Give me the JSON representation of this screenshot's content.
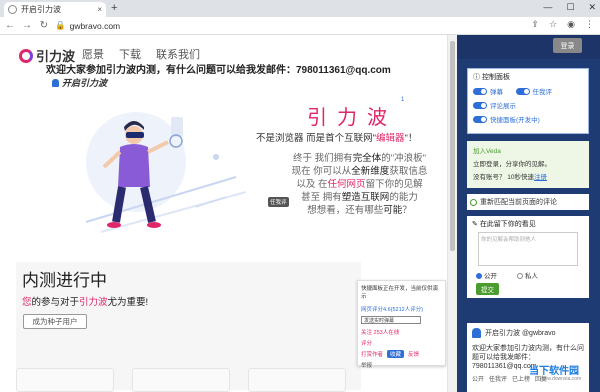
{
  "browser": {
    "tab_title": "开启引力波",
    "tab_close": "×",
    "new_tab": "+",
    "url": "gwbravo.com",
    "win_min": "—",
    "win_max": "☐",
    "win_close": "✕"
  },
  "site": {
    "logo_text": "引力波",
    "nav": [
      "愿景",
      "下载",
      "联系我们"
    ],
    "welcome": "欢迎大家参加引力波内测，有什么问题可以给我发邮件：798011361@qq.com",
    "start_label": "开启引力波",
    "hero_title": "引力波",
    "hero_version": "1",
    "line1_prefix": "不是浏览器 而是首个互联网\"",
    "line1_highlight": "编辑器",
    "line1_suffix": "\"！",
    "para_1": "终于 我们拥有",
    "para_1b": "完全体",
    "para_1c": "的\"冲浪板\"",
    "para_2": "现在 你可以从",
    "para_2b": "全新维度",
    "para_2c": "获取信息",
    "para_3": "以及 在",
    "para_3b": "任何网页",
    "para_3c": "留下你的见解",
    "para_4": "甚至 拥有",
    "para_4b": "塑造互联网",
    "para_4c": "的能力",
    "para_5": "想想看，还有哪些",
    "para_5b": "可能",
    "para_5c": "？",
    "tooltip": "任我评",
    "beta_title": "内测进行中",
    "beta_sub_pre": "您",
    "beta_sub_mid": "的参与对于",
    "beta_sub_pk": "引力波",
    "beta_sub_post": "尤为重要!",
    "beta_button": "成为种子用户"
  },
  "popup": {
    "title": "快捷面板正在开发，当前仅供演示",
    "version_line": "网页评分4.6(5212人评分)",
    "input_value": "发送实时弹幕",
    "row1": "关注    253人在线",
    "row2": "评分",
    "footer_left": "打赏作者",
    "footer_btn": "收藏",
    "footer_right": "反馈",
    "last": "举报"
  },
  "sidebar": {
    "login": "登录",
    "control_title": "控制面板",
    "toggles": [
      "弹幕",
      "任我评",
      "评论展示",
      "快捷面板(开发中)"
    ],
    "veda_title": "加入Veda",
    "veda_text": "立即登录，分享你的见解。",
    "veda_bind_pre": "没有账号？ 10秒快速",
    "veda_bind_link": "注册",
    "rematch": "重新匹配当前页面的评论",
    "comment_title": "在此留下你的看见",
    "comment_placeholder": "你的见解会帮助到他人",
    "radio_public": "公开",
    "radio_private": "私人",
    "submit": "提交",
    "user_name": "开启引力波 @gwbravo",
    "user_text": "欢迎大家参加引力波内测，有什么问题可以给我发邮件：798011361@qq.com",
    "acts": [
      "公开",
      "任我评",
      "已上榜",
      "回复"
    ]
  },
  "watermark": {
    "line1": "当下软件园",
    "line2": "www.downxia.com"
  },
  "colors": {
    "accent": "#e0266a",
    "blue": "#2d6fd6",
    "sidebar": "#1f3b73"
  }
}
